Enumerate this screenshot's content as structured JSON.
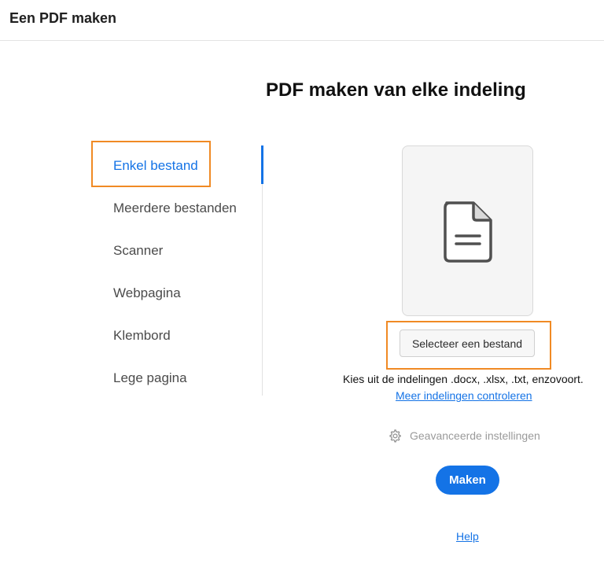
{
  "header": {
    "title": "Een PDF maken"
  },
  "main": {
    "heading": "PDF maken van elke indeling"
  },
  "sidebar": {
    "active_index": 0,
    "items": [
      {
        "label": "Enkel bestand"
      },
      {
        "label": "Meerdere bestanden"
      },
      {
        "label": "Scanner"
      },
      {
        "label": "Webpagina"
      },
      {
        "label": "Klembord"
      },
      {
        "label": "Lege pagina"
      }
    ]
  },
  "file_panel": {
    "icon": "document-icon",
    "select_button_label": "Selecteer een bestand",
    "formats_text": "Kies uit de indelingen .docx, .xlsx, .txt, enzovoort.",
    "formats_link": "Meer indelingen controleren",
    "advanced_icon": "gear-icon",
    "advanced_label": "Geavanceerde instellingen",
    "make_button_label": "Maken",
    "help_link": "Help"
  },
  "colors": {
    "accent": "#1473e6",
    "highlight": "#f08a24",
    "muted": "#9a9a9a"
  }
}
